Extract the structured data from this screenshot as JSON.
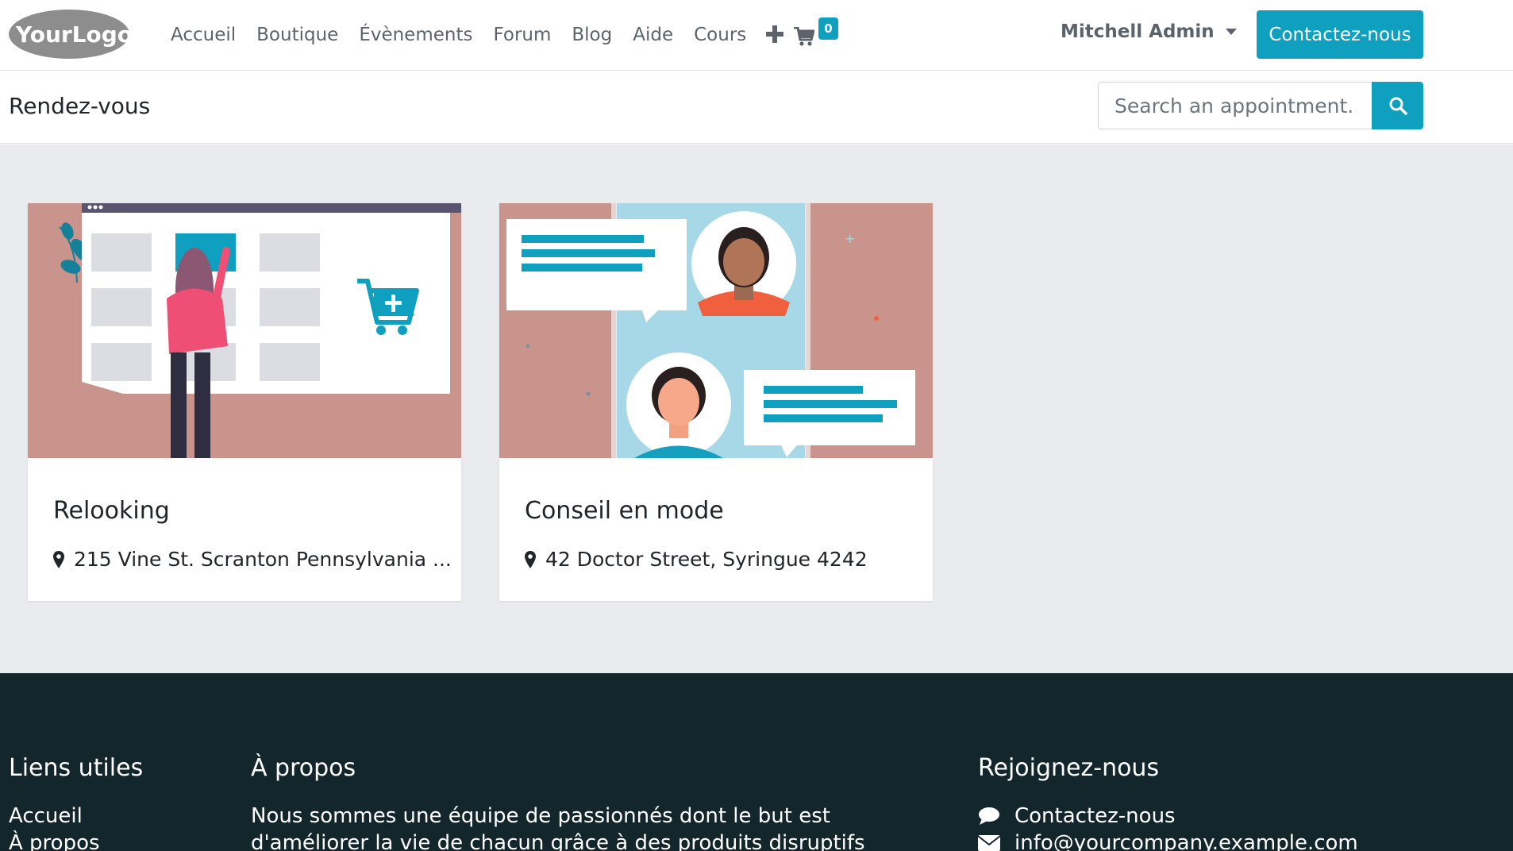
{
  "header": {
    "logo_text": "YourLogo",
    "nav": [
      "Accueil",
      "Boutique",
      "Évènements",
      "Forum",
      "Blog",
      "Aide",
      "Cours"
    ],
    "cart_count": "0",
    "user_name": "Mitchell Admin",
    "contact_label": "Contactez-nous"
  },
  "subheader": {
    "title": "Rendez-vous",
    "search_placeholder": "Search an appointment..."
  },
  "cards": [
    {
      "title": "Relooking",
      "location": "215 Vine St. Scranton Pennsylvania ..."
    },
    {
      "title": "Conseil en mode",
      "location": "42 Doctor Street, Syringue 4242"
    }
  ],
  "footer": {
    "col1": {
      "title": "Liens utiles",
      "links": [
        "Accueil",
        "À propos"
      ]
    },
    "col2": {
      "title": "À propos",
      "text_line1": "Nous sommes une équipe de passionnés dont le but est",
      "text_line2": "d'améliorer la vie de chacun grâce à des produits disruptifs"
    },
    "col3": {
      "title": "Rejoignez-nous",
      "contact": "Contactez-nous",
      "email": "info@yourcompany.example.com"
    }
  },
  "colors": {
    "primary": "#0fa0c0",
    "footer_bg": "#13262c",
    "main_bg": "#eaebee",
    "illustration_bg": "#c9948b"
  },
  "icons": [
    "plus-icon",
    "cart-icon",
    "caret-down-icon",
    "search-icon",
    "map-marker-icon",
    "comment-icon",
    "envelope-icon"
  ]
}
